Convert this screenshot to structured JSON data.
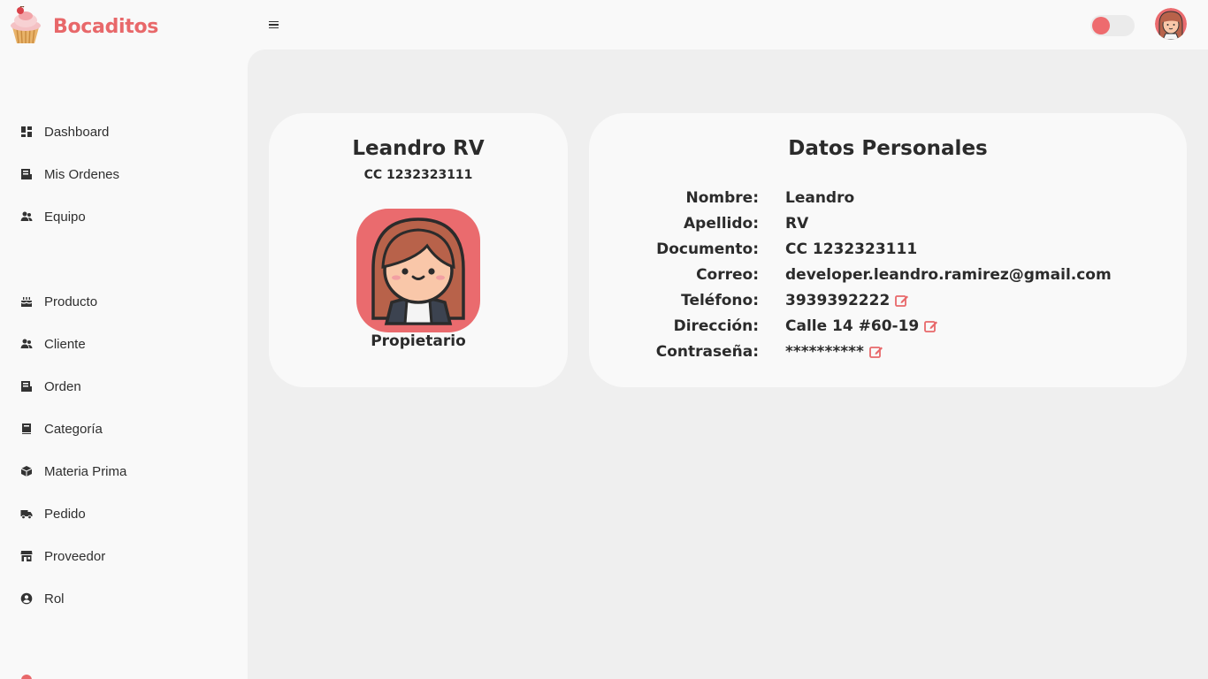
{
  "brand": {
    "name": "Bocaditos",
    "logo_icon": "cupcake-icon",
    "color": "#e8686a"
  },
  "header": {
    "menu_icon": "hamburger-icon",
    "theme_toggle_color": "#ee6b6e",
    "avatar_icon": "user-avatar-icon"
  },
  "sidebar": {
    "items": [
      {
        "label": "Dashboard",
        "icon": "dashboard-icon"
      },
      {
        "label": "Mis Ordenes",
        "icon": "receipt-icon"
      },
      {
        "label": "Equipo",
        "icon": "users-icon"
      },
      {
        "label": "Producto",
        "icon": "cake-icon"
      },
      {
        "label": "Cliente",
        "icon": "users-icon"
      },
      {
        "label": "Orden",
        "icon": "receipt-icon"
      },
      {
        "label": "Categoría",
        "icon": "book-icon"
      },
      {
        "label": "Materia Prima",
        "icon": "box-icon"
      },
      {
        "label": "Pedido",
        "icon": "truck-icon"
      },
      {
        "label": "Proveedor",
        "icon": "store-icon"
      },
      {
        "label": "Rol",
        "icon": "user-circle-icon"
      }
    ]
  },
  "profile": {
    "name": "Leandro RV",
    "document": "CC 1232323111",
    "role": "Propietario",
    "avatar_bg": "#ea6b6e"
  },
  "personal": {
    "title": "Datos Personales",
    "rows": [
      {
        "label": "Nombre:",
        "value": "Leandro",
        "editable": false
      },
      {
        "label": "Apellido:",
        "value": "RV",
        "editable": false
      },
      {
        "label": "Documento:",
        "value": "CC 1232323111",
        "editable": false
      },
      {
        "label": "Correo:",
        "value": "developer.leandro.ramirez@gmail.com",
        "editable": false
      },
      {
        "label": "Teléfono:",
        "value": "3939392222",
        "editable": true
      },
      {
        "label": "Dirección:",
        "value": "Calle 14 #60-19",
        "editable": true
      },
      {
        "label": "Contraseña:",
        "value": "**********",
        "editable": true
      }
    ],
    "accent": "#e8686a"
  }
}
